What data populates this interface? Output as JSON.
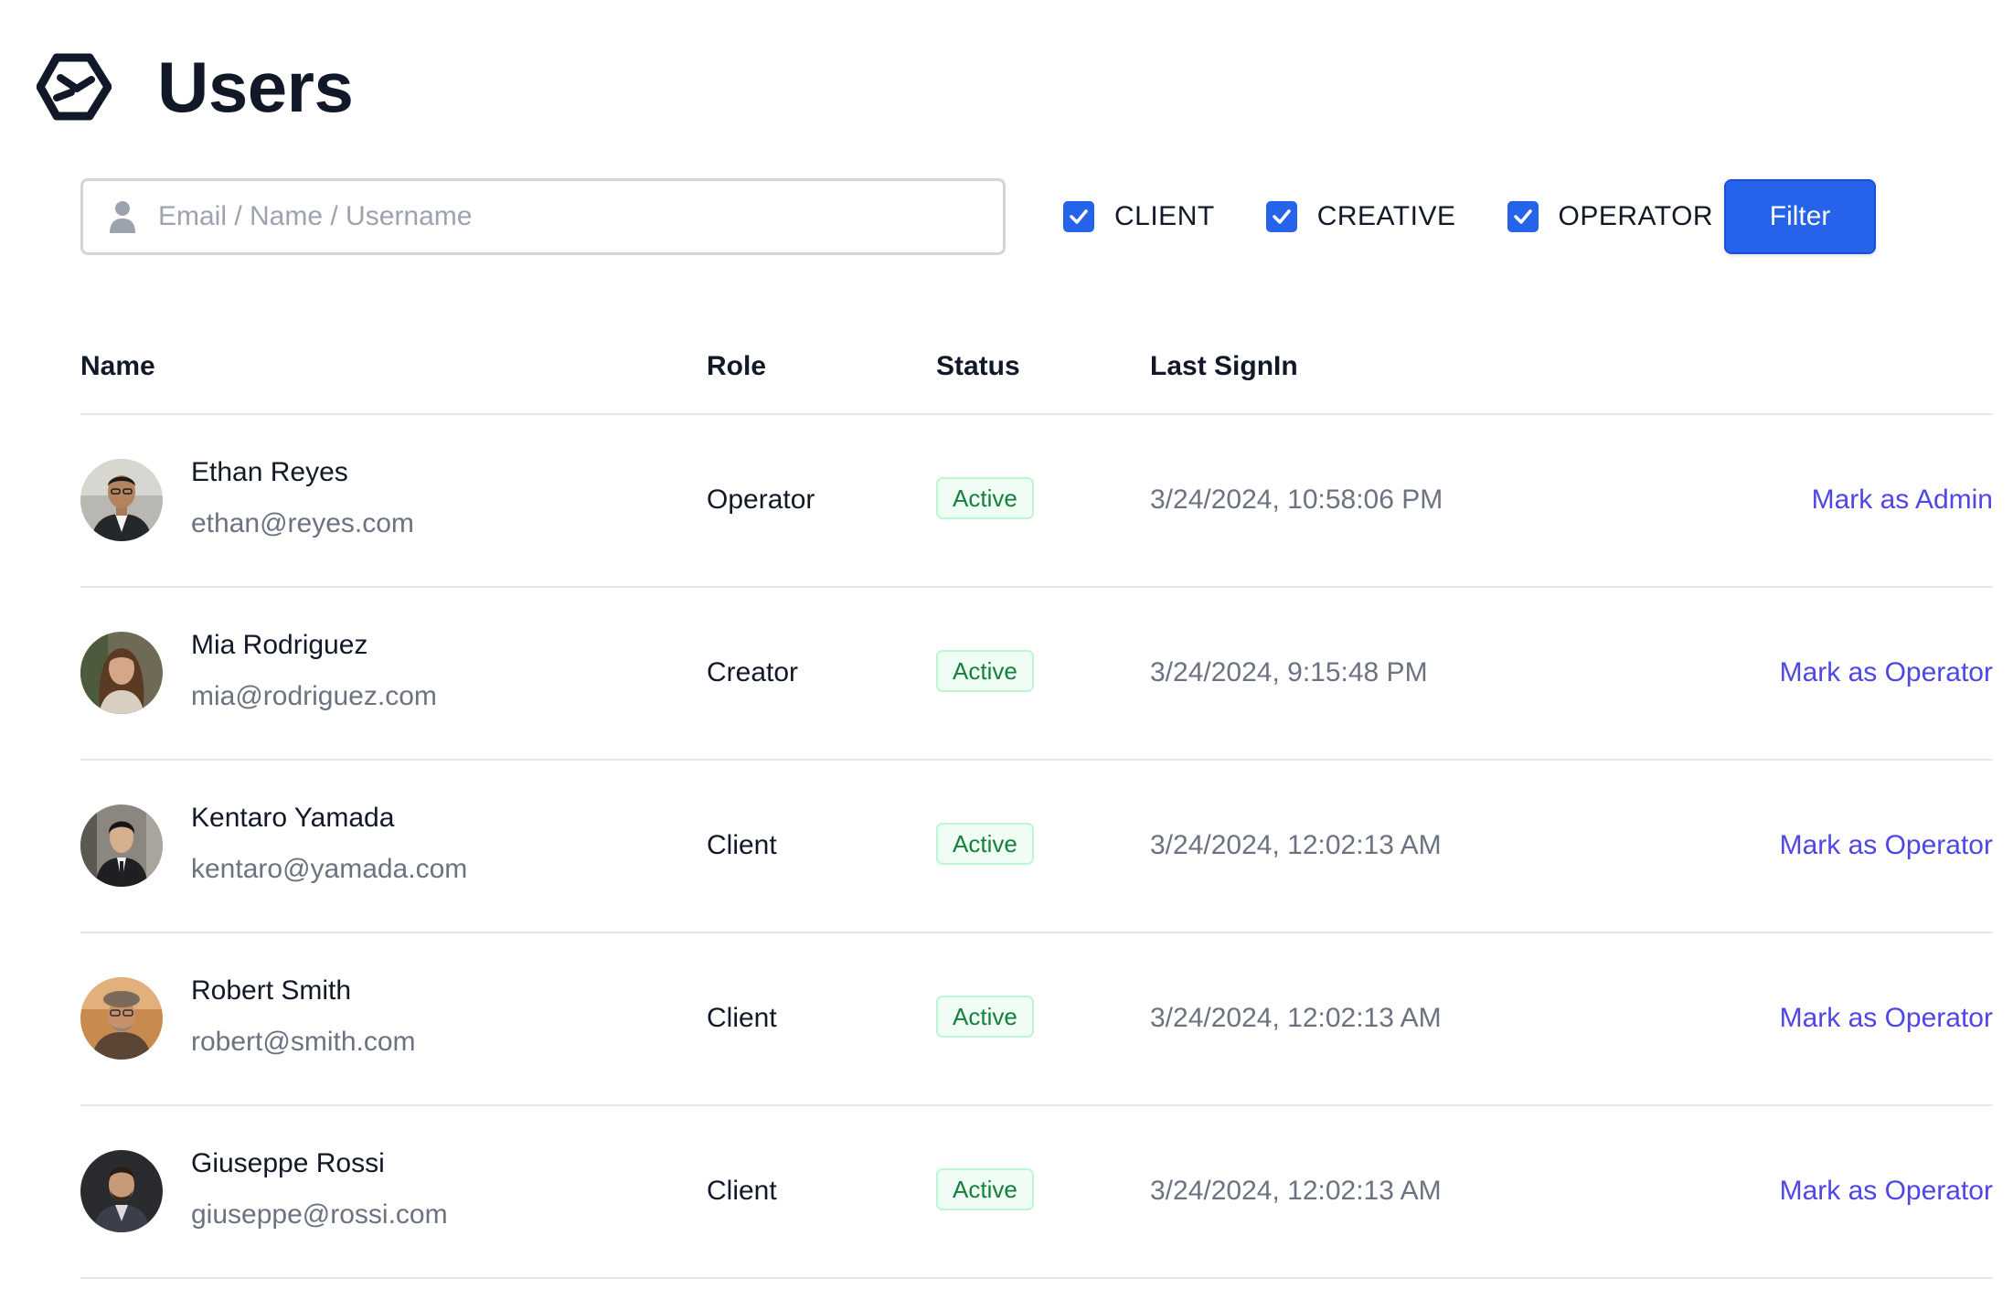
{
  "header": {
    "title": "Users",
    "logo_icon": "hexagon-link-logo"
  },
  "search": {
    "placeholder": "Email / Name / Username",
    "value": ""
  },
  "filters": [
    {
      "label": "CLIENT",
      "checked": true
    },
    {
      "label": "CREATIVE",
      "checked": true
    },
    {
      "label": "OPERATOR",
      "checked": true
    }
  ],
  "filter_button": {
    "label": "Filter"
  },
  "table": {
    "columns": {
      "name": "Name",
      "role": "Role",
      "status": "Status",
      "last_signin": "Last SignIn"
    },
    "rows": [
      {
        "name": "Ethan Reyes",
        "email": "ethan@reyes.com",
        "role": "Operator",
        "status": "Active",
        "last_signin": "3/24/2024, 10:58:06 PM",
        "action": "Mark as Admin"
      },
      {
        "name": "Mia Rodriguez",
        "email": "mia@rodriguez.com",
        "role": "Creator",
        "status": "Active",
        "last_signin": "3/24/2024, 9:15:48 PM",
        "action": "Mark as Operator"
      },
      {
        "name": "Kentaro Yamada",
        "email": "kentaro@yamada.com",
        "role": "Client",
        "status": "Active",
        "last_signin": "3/24/2024, 12:02:13 AM",
        "action": "Mark as Operator"
      },
      {
        "name": "Robert Smith",
        "email": "robert@smith.com",
        "role": "Client",
        "status": "Active",
        "last_signin": "3/24/2024, 12:02:13 AM",
        "action": "Mark as Operator"
      },
      {
        "name": "Giuseppe Rossi",
        "email": "giuseppe@rossi.com",
        "role": "Client",
        "status": "Active",
        "last_signin": "3/24/2024, 12:02:13 AM",
        "action": "Mark as Operator"
      }
    ]
  },
  "colors": {
    "primary": "#2563eb",
    "link": "#4f46e5",
    "status_active_text": "#15803d",
    "status_active_bg": "#f0fdf4"
  }
}
